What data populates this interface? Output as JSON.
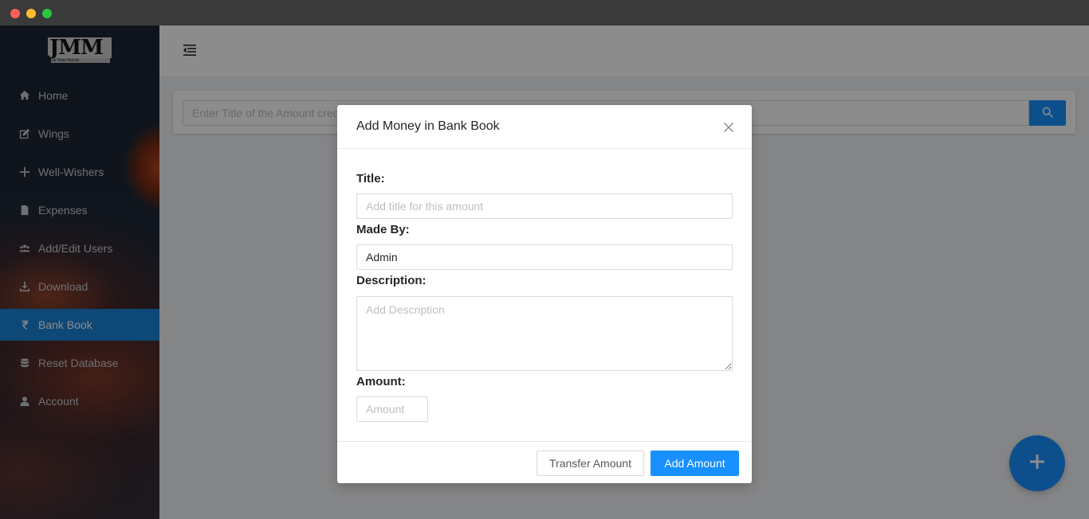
{
  "window": {
    "controls": [
      "close",
      "minimize",
      "maximize"
    ]
  },
  "sidebar": {
    "logo_text": "JMM",
    "logo_subtext": "Jai Mata Mandir",
    "items": [
      {
        "label": "Home",
        "icon": "home-icon"
      },
      {
        "label": "Wings",
        "icon": "edit-icon"
      },
      {
        "label": "Well-Wishers",
        "icon": "plus-icon"
      },
      {
        "label": "Expenses",
        "icon": "document-icon"
      },
      {
        "label": "Add/Edit Users",
        "icon": "users-icon"
      },
      {
        "label": "Download",
        "icon": "download-icon"
      },
      {
        "label": "Bank Book",
        "icon": "rupee-icon",
        "active": true
      },
      {
        "label": "Reset Database",
        "icon": "database-icon"
      },
      {
        "label": "Account",
        "icon": "user-icon"
      }
    ]
  },
  "main": {
    "search": {
      "placeholder": "Enter Title of the Amount credited"
    }
  },
  "modal": {
    "title": "Add Money in Bank Book",
    "fields": {
      "title": {
        "label": "Title:",
        "placeholder": "Add title for this amount",
        "value": ""
      },
      "made_by": {
        "label": "Made By:",
        "value": "Admin"
      },
      "description": {
        "label": "Description:",
        "placeholder": "Add Description",
        "value": ""
      },
      "amount": {
        "label": "Amount:",
        "placeholder": "Amount",
        "value": ""
      }
    },
    "buttons": {
      "transfer": "Transfer Amount",
      "add": "Add Amount"
    }
  },
  "colors": {
    "primary": "#1890ff",
    "sidebar_active": "#1a84d8"
  }
}
